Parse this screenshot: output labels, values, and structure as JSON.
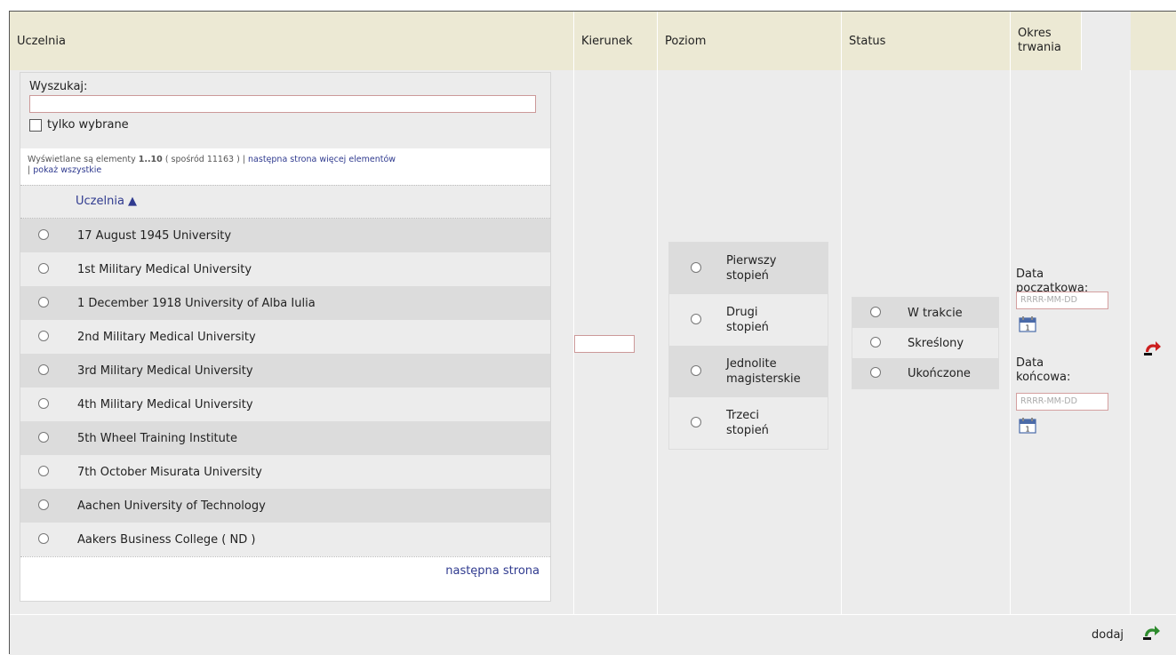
{
  "headers": {
    "uczelnia": "Uczelnia",
    "kierunek": "Kierunek",
    "poziom": "Poziom",
    "status": "Status",
    "okres": "Okres trwania"
  },
  "search": {
    "label": "Wyszukaj:",
    "value": "",
    "only_selected_label": "tylko wybrane",
    "info_prefix": "Wyświetlane są elementy ",
    "info_range": "1..10",
    "info_mid": " ( spośród 11163 ) | ",
    "info_next": "następna strona",
    "info_more": "więcej elementów",
    "info_sep": " | ",
    "info_all": "pokaż wszystkie",
    "column_header": "Uczelnia ▲"
  },
  "universities": [
    "17 August 1945 University",
    "1st Military Medical University",
    "1 December 1918 University of Alba Iulia",
    "2nd Military Medical University",
    "3rd Military Medical University",
    "4th Military Medical University",
    "5th Wheel Training Institute",
    "7th October Misurata University",
    "Aachen University of Technology",
    "Aakers Business College ( ND )"
  ],
  "next_page": "następna strona",
  "poziom_options": [
    [
      "Pierwszy",
      "stopień"
    ],
    [
      "Drugi",
      "stopień"
    ],
    [
      "Jednolite",
      "magisterskie"
    ],
    [
      "Trzeci",
      "stopień"
    ]
  ],
  "status_options": [
    "W trakcie",
    "Skreślony",
    "Ukończone"
  ],
  "okres": {
    "start_label_1": "Data",
    "start_label_2": "początkowa:",
    "end_label_1": "Data",
    "end_label_2": "końcowa:",
    "date_placeholder": "RRRR-MM-DD",
    "calendar_day": "1"
  },
  "add_label": "dodaj",
  "colors": {
    "header_bg": "#ece9d4",
    "link": "#2f3a8f",
    "remove_icon": "#cc1f1f",
    "add_icon": "#2e8b2e"
  },
  "icons": {
    "remove": "undo-arrow-icon",
    "add": "undo-arrow-icon",
    "calendar": "calendar-icon"
  }
}
